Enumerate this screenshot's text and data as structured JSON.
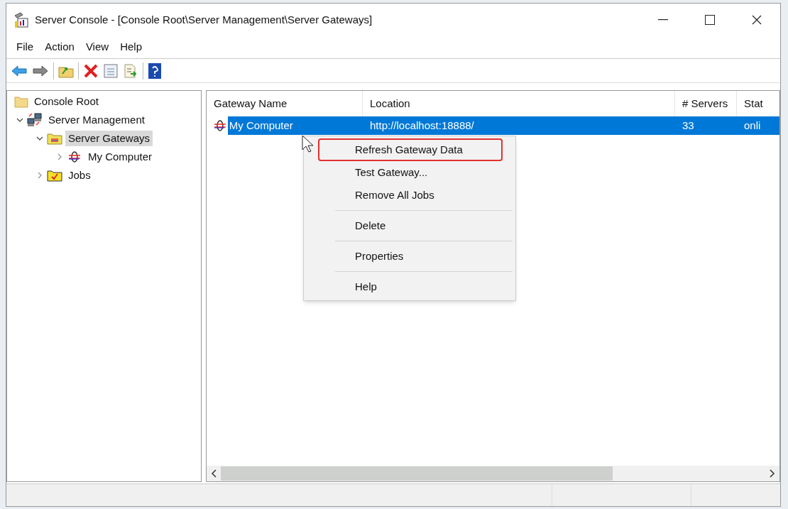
{
  "window": {
    "title": "Server Console - [Console Root\\Server Management\\Server Gateways]"
  },
  "menu_bar": [
    "File",
    "Action",
    "View",
    "Help"
  ],
  "tree": [
    {
      "label": "Console Root",
      "kind": "folder",
      "selected": false,
      "children": [
        {
          "label": "Server Management",
          "kind": "servers",
          "expanded": true,
          "selected": false,
          "children": [
            {
              "label": "Server Gateways",
              "kind": "gateways",
              "expanded": true,
              "selected": true,
              "children": [
                {
                  "label": "My Computer",
                  "kind": "gateway",
                  "expanded": false,
                  "selected": false
                }
              ]
            },
            {
              "label": "Jobs",
              "kind": "jobs",
              "expanded": false,
              "selected": false
            }
          ]
        }
      ]
    }
  ],
  "list": {
    "columns": [
      "Gateway Name",
      "Location",
      "# Servers",
      "Stat"
    ],
    "rows": [
      {
        "cells": [
          "My Computer",
          "http://localhost:18888/",
          "33",
          "onli"
        ],
        "selected": true
      }
    ]
  },
  "context_menu": {
    "items": [
      {
        "label": "Refresh Gateway Data",
        "outlined": true,
        "separator_before": false
      },
      {
        "label": "Test Gateway...",
        "outlined": false,
        "separator_before": false
      },
      {
        "label": "Remove All Jobs",
        "outlined": false,
        "separator_before": false
      },
      {
        "label": "Delete",
        "outlined": false,
        "separator_before": true
      },
      {
        "label": "Properties",
        "outlined": false,
        "separator_before": true
      },
      {
        "label": "Help",
        "outlined": false,
        "separator_before": true
      }
    ]
  }
}
